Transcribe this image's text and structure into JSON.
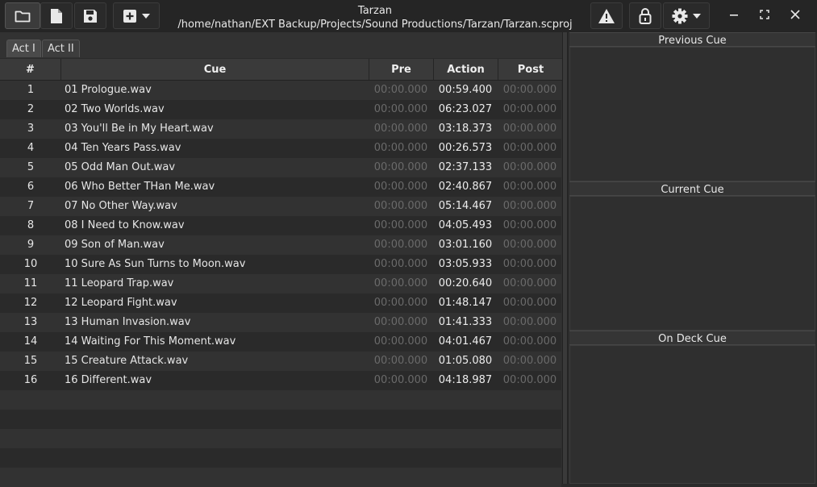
{
  "window": {
    "title": "Tarzan",
    "path": "/home/nathan/EXT Backup/Projects/Sound Productions/Tarzan/Tarzan.scproj"
  },
  "toolbar": {
    "open_icon": "folder-icon",
    "new_icon": "new-file-icon",
    "save_icon": "save-icon",
    "add_icon": "add-cue-icon",
    "warning_icon": "warning-icon",
    "lock_icon": "lock-icon",
    "settings_icon": "gear-icon"
  },
  "tabs": [
    {
      "label": "Act I"
    },
    {
      "label": "Act II"
    }
  ],
  "table": {
    "headers": {
      "num": "#",
      "cue": "Cue",
      "pre": "Pre",
      "action": "Action",
      "post": "Post"
    },
    "rows": [
      {
        "num": "1",
        "cue": "01 Prologue.wav",
        "pre": "00:00.000",
        "action": "00:59.400",
        "post": "00:00.000"
      },
      {
        "num": "2",
        "cue": "02 Two Worlds.wav",
        "pre": "00:00.000",
        "action": "06:23.027",
        "post": "00:00.000"
      },
      {
        "num": "3",
        "cue": "03 You'll Be in My Heart.wav",
        "pre": "00:00.000",
        "action": "03:18.373",
        "post": "00:00.000"
      },
      {
        "num": "4",
        "cue": "04 Ten Years Pass.wav",
        "pre": "00:00.000",
        "action": "00:26.573",
        "post": "00:00.000"
      },
      {
        "num": "5",
        "cue": "05 Odd Man Out.wav",
        "pre": "00:00.000",
        "action": "02:37.133",
        "post": "00:00.000"
      },
      {
        "num": "6",
        "cue": "06 Who Better THan Me.wav",
        "pre": "00:00.000",
        "action": "02:40.867",
        "post": "00:00.000"
      },
      {
        "num": "7",
        "cue": "07 No Other Way.wav",
        "pre": "00:00.000",
        "action": "05:14.467",
        "post": "00:00.000"
      },
      {
        "num": "8",
        "cue": "08 I Need to Know.wav",
        "pre": "00:00.000",
        "action": "04:05.493",
        "post": "00:00.000"
      },
      {
        "num": "9",
        "cue": "09 Son of Man.wav",
        "pre": "00:00.000",
        "action": "03:01.160",
        "post": "00:00.000"
      },
      {
        "num": "10",
        "cue": "10 Sure As Sun Turns to Moon.wav",
        "pre": "00:00.000",
        "action": "03:05.933",
        "post": "00:00.000"
      },
      {
        "num": "11",
        "cue": "11 Leopard Trap.wav",
        "pre": "00:00.000",
        "action": "00:20.640",
        "post": "00:00.000"
      },
      {
        "num": "12",
        "cue": "12 Leopard Fight.wav",
        "pre": "00:00.000",
        "action": "01:48.147",
        "post": "00:00.000"
      },
      {
        "num": "13",
        "cue": "13 Human Invasion.wav",
        "pre": "00:00.000",
        "action": "01:41.333",
        "post": "00:00.000"
      },
      {
        "num": "14",
        "cue": "14 Waiting For This Moment.wav",
        "pre": "00:00.000",
        "action": "04:01.467",
        "post": "00:00.000"
      },
      {
        "num": "15",
        "cue": "15 Creature Attack.wav",
        "pre": "00:00.000",
        "action": "01:05.080",
        "post": "00:00.000"
      },
      {
        "num": "16",
        "cue": "16 Different.wav",
        "pre": "00:00.000",
        "action": "04:18.987",
        "post": "00:00.000"
      }
    ]
  },
  "panels": {
    "previous": "Previous Cue",
    "current": "Current Cue",
    "on_deck": "On Deck Cue"
  }
}
